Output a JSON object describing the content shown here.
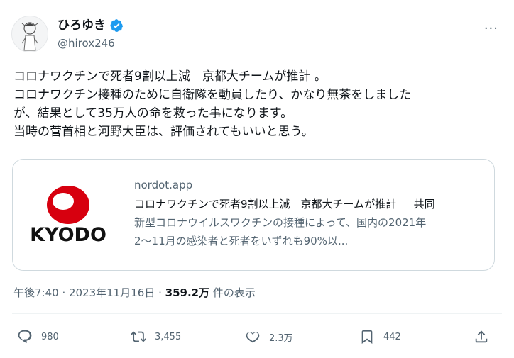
{
  "user": {
    "display_name": "ひろゆき",
    "handle": "@hirox246"
  },
  "more_label": "···",
  "text_lines": [
    "コロナワクチンで死者9割以上減　京都大チームが推計 。",
    "コロナワクチン接種のために自衛隊を動員したり、かなり無茶をしました",
    "が、結果として35万人の命を救った事になります。",
    "当時の菅首相と河野大臣は、評価されてもいいと思う。"
  ],
  "card": {
    "logo_text": "KYODO",
    "domain": "nordot.app",
    "title": "コロナワクチンで死者9割以上減　京都大チームが推計 ｜ 共同",
    "desc_line1": "新型コロナウイルスワクチンの接種によって、国内の2021年",
    "desc_line2": "2～11月の感染者と死者をいずれも90%以..."
  },
  "meta": {
    "time_date": "午後7:40 · 2023年11月16日 · ",
    "views": "359.2万",
    "views_suffix": " 件の表示"
  },
  "actions": {
    "replies": "980",
    "reposts": "3,455",
    "likes": "2.3万",
    "bookmarks": "442"
  },
  "icons": [
    "verified-badge-icon",
    "more-icon",
    "reply-icon",
    "repost-icon",
    "like-icon",
    "bookmark-icon",
    "share-icon"
  ],
  "colors": {
    "verified": "#1d9bf0",
    "secondary": "#536471",
    "kyodo_red": "#d7000f"
  }
}
